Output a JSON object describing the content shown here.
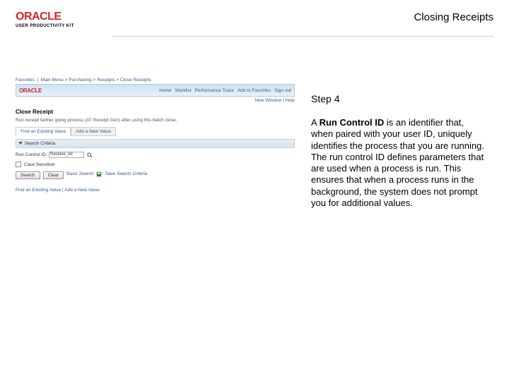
{
  "header": {
    "brand": "ORACLE",
    "sub_brand": "USER PRODUCTIVITY KIT",
    "title": "Closing Receipts"
  },
  "instruction": {
    "step_label": "Step 4",
    "body_prefix": "A ",
    "body_bold": "Run Control ID",
    "body_rest": " is an identifier that, when paired with your user ID, uniquely identifies the process that you are running. The run control ID defines parameters that are used when a process is run. This ensures that when a process runs in the background, the system does not prompt you for additional values."
  },
  "shot": {
    "breadcrumb": [
      "Favorites",
      "Main Menu",
      "Purchasing",
      "Receipts",
      "Close Receipts"
    ],
    "brand": "ORACLE",
    "topnav": [
      "Home",
      "Worklist",
      "Performance Trace",
      "Add to Favorites",
      "Sign out"
    ],
    "subline": "New Window | Help",
    "page_title": "Close Receipt",
    "page_desc": "Run receipt farther going process (AT Receipt Gen) after using this batch close.",
    "tab_inactive": "Find an Existing Value",
    "tab_active": "Add a New Value",
    "section_title": "Search Criteria",
    "run_control_label": "Run Control ID",
    "run_control_value": "Receive_All",
    "case_sensitive": "Case Sensitive",
    "btn_search": "Search",
    "btn_clear": "Clear",
    "link_basic": "Basic Search",
    "link_save": "Save Search Criteria",
    "footer": "Find an Existing Value | Add a New Value"
  }
}
